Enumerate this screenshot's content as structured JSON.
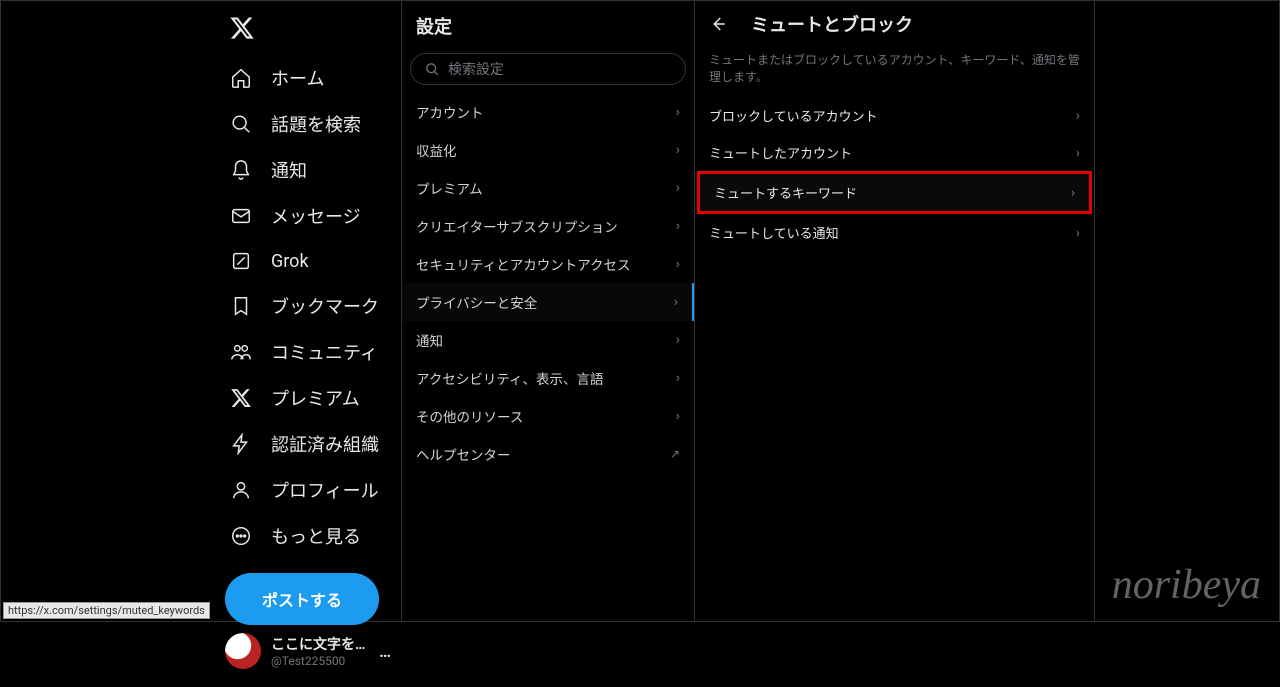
{
  "sidebar": {
    "items": [
      {
        "label": "ホーム"
      },
      {
        "label": "話題を検索"
      },
      {
        "label": "通知"
      },
      {
        "label": "メッセージ"
      },
      {
        "label": "Grok"
      },
      {
        "label": "ブックマーク"
      },
      {
        "label": "コミュニティ"
      },
      {
        "label": "プレミアム"
      },
      {
        "label": "認証済み組織"
      },
      {
        "label": "プロフィール"
      },
      {
        "label": "もっと見る"
      }
    ],
    "post_label": "ポストする",
    "account": {
      "name": "ここに文字を入力しま",
      "handle": "@Test225500",
      "more": "…"
    }
  },
  "settings": {
    "title": "設定",
    "search_placeholder": "検索設定",
    "items": [
      {
        "label": "アカウント"
      },
      {
        "label": "収益化"
      },
      {
        "label": "プレミアム"
      },
      {
        "label": "クリエイターサブスクリプション"
      },
      {
        "label": "セキュリティとアカウントアクセス"
      },
      {
        "label": "プライバシーと安全"
      },
      {
        "label": "通知"
      },
      {
        "label": "アクセシビリティ、表示、言語"
      },
      {
        "label": "その他のリソース"
      },
      {
        "label": "ヘルプセンター"
      }
    ]
  },
  "detail": {
    "title": "ミュートとブロック",
    "description": "ミュートまたはブロックしているアカウント、キーワード、通知を管理します。",
    "items": [
      {
        "label": "ブロックしているアカウント"
      },
      {
        "label": "ミュートしたアカウント"
      },
      {
        "label": "ミュートするキーワード"
      },
      {
        "label": "ミュートしている通知"
      }
    ]
  },
  "status_url": "https://x.com/settings/muted_keywords",
  "watermark": "noribeya"
}
